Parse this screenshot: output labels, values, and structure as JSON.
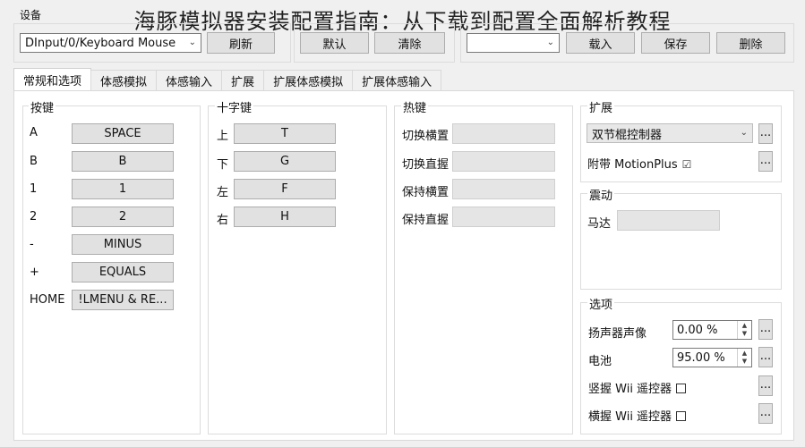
{
  "overlay_title": "海豚模拟器安装配置指南：从下载到配置全面解析教程",
  "device": {
    "label": "设备",
    "selected": "DInput/0/Keyboard Mouse",
    "refresh": "刷新",
    "default": "默认",
    "clear": "清除",
    "profile_value": "",
    "load": "载入",
    "save": "保存",
    "delete": "删除"
  },
  "tabs": [
    "常规和选项",
    "体感模拟",
    "体感输入",
    "扩展",
    "扩展体感模拟",
    "扩展体感输入"
  ],
  "buttons_group": {
    "title": "按键",
    "rows": [
      {
        "label": "A",
        "value": "SPACE"
      },
      {
        "label": "B",
        "value": "B"
      },
      {
        "label": "1",
        "value": "1"
      },
      {
        "label": "2",
        "value": "2"
      },
      {
        "label": "-",
        "value": "MINUS"
      },
      {
        "label": "+",
        "value": "EQUALS"
      },
      {
        "label": "HOME",
        "value": "!LMENU & RE..."
      }
    ]
  },
  "dpad_group": {
    "title": "十字键",
    "rows": [
      {
        "label": "上",
        "value": "T"
      },
      {
        "label": "下",
        "value": "G"
      },
      {
        "label": "左",
        "value": "F"
      },
      {
        "label": "右",
        "value": "H"
      }
    ]
  },
  "hotkeys_group": {
    "title": "热键",
    "rows": [
      {
        "label": "切换横置",
        "value": ""
      },
      {
        "label": "切换直握",
        "value": ""
      },
      {
        "label": "保持横置",
        "value": ""
      },
      {
        "label": "保持直握",
        "value": ""
      }
    ]
  },
  "extension_group": {
    "title": "扩展",
    "selected": "双节棍控制器",
    "motionplus_label": "附带 MotionPlus",
    "motionplus_checked": true,
    "more": "..."
  },
  "rumble_group": {
    "title": "震动",
    "motor_label": "马达",
    "motor_value": ""
  },
  "options_group": {
    "title": "选项",
    "speaker_label": "扬声器声像",
    "speaker_value": "0.00 %",
    "battery_label": "电池",
    "battery_value": "95.00 %",
    "upright_label": "竖握 Wii 遥控器",
    "sideways_label": "横握 Wii 遥控器",
    "more": "..."
  }
}
